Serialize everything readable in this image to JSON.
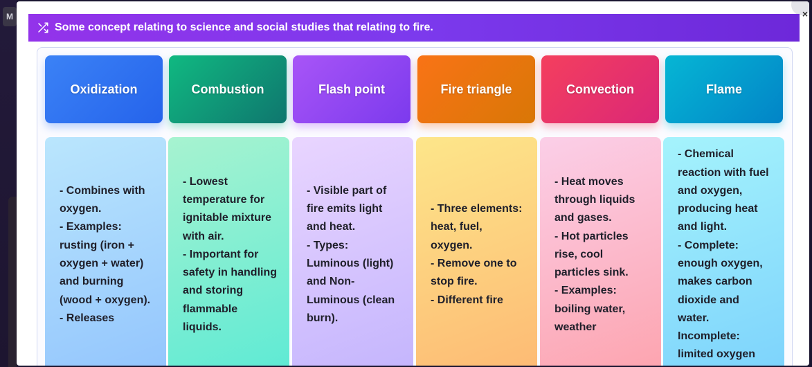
{
  "background": {
    "tag": "M"
  },
  "modal": {
    "close_label": "×",
    "header": {
      "icon": "shuffle-icon",
      "title": "Some concept relating to science and social studies that relating to fire."
    },
    "columns": [
      {
        "title": "Oxidization",
        "color_from": "#3b82f6",
        "color_to": "#2563eb",
        "detail_from": "#bae6fd",
        "detail_to": "#93c5fd",
        "text": "- Combines with oxygen.\n- Examples: rusting (iron + oxygen + water) and burning (wood + oxygen).\n- Releases"
      },
      {
        "title": "Combustion",
        "color_from": "#10b981",
        "color_to": "#0f766e",
        "detail_from": "#a7f3d0",
        "detail_to": "#5eead4",
        "text": "- Lowest temperature for ignitable mixture with air.\n- Important for safety in handling and storing flammable liquids."
      },
      {
        "title": "Flash point",
        "color_from": "#a855f7",
        "color_to": "#7c3aed",
        "detail_from": "#e9d5ff",
        "detail_to": "#c4b5fd",
        "text": "- Visible part of fire emits light and heat.\n- Types: Luminous (light) and Non-Luminous (clean burn)."
      },
      {
        "title": "Fire triangle",
        "color_from": "#f97316",
        "color_to": "#d97706",
        "detail_from": "#fde68a",
        "detail_to": "#fdba74",
        "text": "- Three elements: heat, fuel, oxygen.\n- Remove one to stop fire.\n- Different fire"
      },
      {
        "title": "Convection",
        "color_from": "#f43f5e",
        "color_to": "#db2777",
        "detail_from": "#fbcfe8",
        "detail_to": "#fda4af",
        "text": "- Heat moves through liquids and gases.\n- Hot particles rise, cool particles sink.\n- Examples: boiling water, weather"
      },
      {
        "title": "Flame",
        "color_from": "#06b6d4",
        "color_to": "#0284c7",
        "detail_from": "#a5f3fc",
        "detail_to": "#7dd3fc",
        "text": "- Chemical reaction with fuel and oxygen, producing heat and light.\n- Complete: enough oxygen, makes carbon dioxide and water.\nIncomplete: limited oxygen"
      }
    ]
  }
}
